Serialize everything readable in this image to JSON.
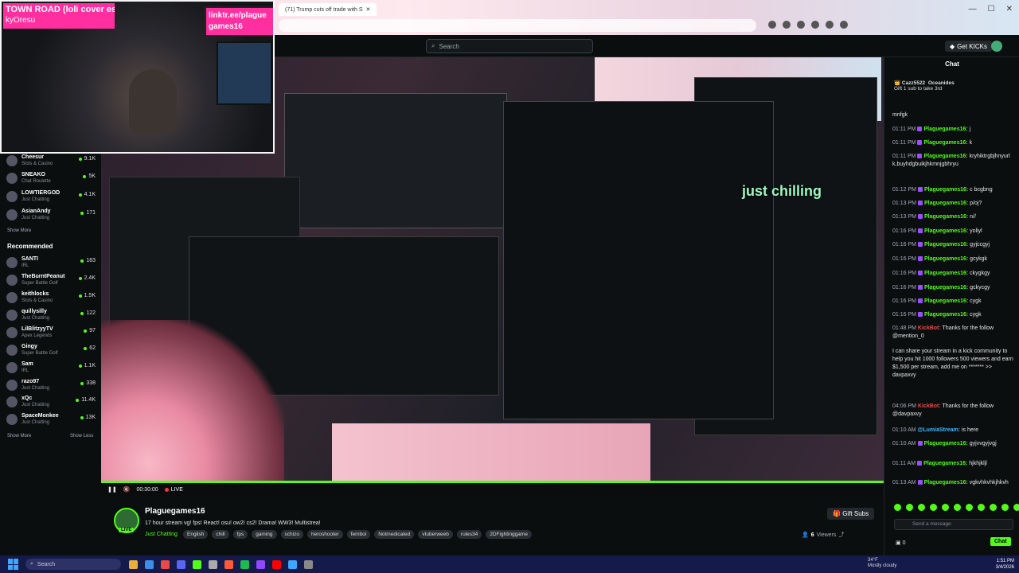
{
  "browser": {
    "tab_title": "(71) Trump cuts off trade with S",
    "new_tab": "+"
  },
  "nav": {
    "search_placeholder": "Search",
    "get_kicks": "Get KICKs"
  },
  "overlay": {
    "song_title": "TOWN ROAD (loli cover esp",
    "song_artist": "kyOresu",
    "linktree": "linktr.ee/plague games16",
    "chilling": "just chilling"
  },
  "sidebar": {
    "following": [
      {
        "name": "Cheesur",
        "category": "Slots & Casino",
        "viewers": "9.1K"
      },
      {
        "name": "SNEAKO",
        "category": "Chat Roulette",
        "viewers": "5K"
      },
      {
        "name": "LOWTIERGOD",
        "category": "Just Chatting",
        "viewers": "4.1K"
      },
      {
        "name": "AsianAndy",
        "category": "Just Chatting",
        "viewers": "171"
      }
    ],
    "show_more": "Show More",
    "recommended_heading": "Recommended",
    "recommended": [
      {
        "name": "SANTI",
        "category": "IRL",
        "viewers": "183"
      },
      {
        "name": "TheBurntPeanut",
        "category": "Super Battle Golf",
        "viewers": "2.4K"
      },
      {
        "name": "keithlocks",
        "category": "Slots & Casino",
        "viewers": "1.5K"
      },
      {
        "name": "quillysilly",
        "category": "Just Chatting",
        "viewers": "122"
      },
      {
        "name": "LilBlitzyyTV",
        "category": "Apex Legends",
        "viewers": "97"
      },
      {
        "name": "Gingy",
        "category": "Super Battle Golf",
        "viewers": "62"
      },
      {
        "name": "Sam",
        "category": "IRL",
        "viewers": "1.1K"
      },
      {
        "name": "razo97",
        "category": "Just Chatting",
        "viewers": "338"
      },
      {
        "name": "xQc",
        "category": "Just Chatting",
        "viewers": "11.4K"
      },
      {
        "name": "SpaceMonkee",
        "category": "Just Chatting",
        "viewers": "13K"
      }
    ],
    "show_more2": "Show More",
    "show_less": "Show Less"
  },
  "player": {
    "time": "00:30:00",
    "live": "LIVE"
  },
  "stream": {
    "channel": "Plaguegames16",
    "live_badge": "LIVE",
    "title": "17 hour stream vg! fps! React! osu! ow2! cs2! Drama! WW3! Multistrea!",
    "category": "Just Chatting",
    "tags": [
      "English",
      "chill",
      "fps",
      "gaming",
      "schizo",
      "heroshooter",
      "femboi",
      "Notmedicated",
      "vtuberweeb",
      "rules34",
      "2DFightinggame"
    ],
    "gift_subs": "Gift Subs",
    "viewers_count": "6",
    "viewers_label": "Viewers"
  },
  "chat": {
    "heading": "Chat",
    "pinned_user": "Cazz5522",
    "pinned_user2": "Oceanides",
    "pinned_text": "Gift 1 sub to take 3rd",
    "messages": [
      {
        "time": "",
        "user": "",
        "text": "mnfgk"
      },
      {
        "time": "01:11 PM",
        "user": "Plaguegames16:",
        "text": "j"
      },
      {
        "time": "01:11 PM",
        "user": "Plaguegames16:",
        "text": "k"
      },
      {
        "time": "01:11 PM",
        "user": "Plaguegames16:",
        "text": "kryhiktrgbjhnyurlk,buyhdgbuikjhkmnjgbhryu"
      },
      {
        "time": "01:12 PM",
        "user": "Plaguegames16:",
        "text": "c bcgbng"
      },
      {
        "time": "01:13 PM",
        "user": "Plaguegames16:",
        "text": "p/oj?"
      },
      {
        "time": "01:13 PM",
        "user": "Plaguegames16:",
        "text": "n//"
      },
      {
        "time": "01:16 PM",
        "user": "Plaguegames16:",
        "text": "yoliyl"
      },
      {
        "time": "01:16 PM",
        "user": "Plaguegames16:",
        "text": "gyjccgyj"
      },
      {
        "time": "01:16 PM",
        "user": "Plaguegames16:",
        "text": "gcykgk"
      },
      {
        "time": "01:16 PM",
        "user": "Plaguegames16:",
        "text": "ckygkgy"
      },
      {
        "time": "01:16 PM",
        "user": "Plaguegames16:",
        "text": "gckycgy"
      },
      {
        "time": "01:16 PM",
        "user": "Plaguegames16:",
        "text": "cygk"
      },
      {
        "time": "01:16 PM",
        "user": "Plaguegames16:",
        "text": "cygk"
      }
    ],
    "bot_time": "01:48 PM",
    "bot_user": "KickBot:",
    "bot_text": "Thanks for the follow @mention_0",
    "promo_text": "I can share your stream in a kick community to help you hit 1000 followers 500 viewers and earn $1,500 per stream, add me on ******* >> davpaxvy",
    "bot2_time": "04:06 PM",
    "bot2_text": "Thanks for the follow @davpaxvy",
    "lumia_time": "01:10 AM",
    "lumia_user": "@LumiaStream:",
    "lumia_text": "is here",
    "late": [
      {
        "time": "01:10 AM",
        "user": "Plaguegames16:",
        "text": "gyjvvgyjvgj"
      },
      {
        "time": "01:11 AM",
        "user": "Plaguegames16:",
        "text": "hjkhjkljl"
      },
      {
        "time": "01:13 AM",
        "user": "Plaguegames16:",
        "text": "vgkvhkvhkjhkvh"
      }
    ],
    "send_placeholder": "Send a message",
    "points": "0",
    "chat_button": "Chat"
  },
  "taskbar": {
    "search": "Search",
    "weather_temp": "34°F",
    "weather_desc": "Mostly cloudy",
    "time": "1:51 PM",
    "date": "3/4/2026"
  },
  "colors": {
    "accent": "#53fc18",
    "overlay_pink": "#ff2fa0",
    "taskbar": "#141a4a"
  }
}
